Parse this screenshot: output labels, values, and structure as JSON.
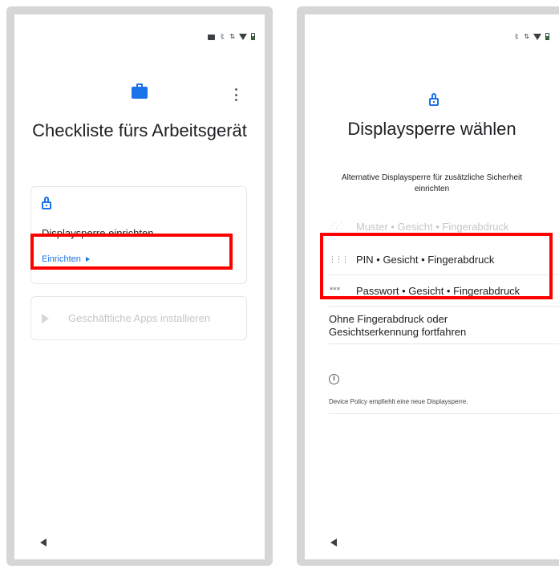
{
  "left_screen": {
    "title": "Checkliste fürs Arbeitsgerät",
    "card_lock": {
      "title": "Displaysperre einrichten",
      "action_label": "Einrichten"
    },
    "card_apps": {
      "title": "Geschäftliche Apps installieren"
    }
  },
  "right_screen": {
    "title": "Displaysperre wählen",
    "subtitle": "Alternative Displaysperre für zusätzliche Sicherheit einrichten",
    "options": [
      {
        "icon": "pattern-icon",
        "label": "Muster • Gesicht • Fingerabdruck",
        "enabled": false
      },
      {
        "icon": "pin-icon",
        "label": "PIN • Gesicht • Fingerabdruck",
        "enabled": true
      },
      {
        "icon": "password-icon",
        "label": "Passwort • Gesicht • Fingerabdruck",
        "enabled": true
      }
    ],
    "without_biometrics": "Ohne Fingerabdruck oder Gesichtserkennung fortfahren",
    "info_note": "Device Policy empfiehlt eine neue Displaysperre."
  },
  "colors": {
    "accent": "#1a73e8",
    "highlight": "#ff0000",
    "disabled_text": "#c4c6ca"
  }
}
